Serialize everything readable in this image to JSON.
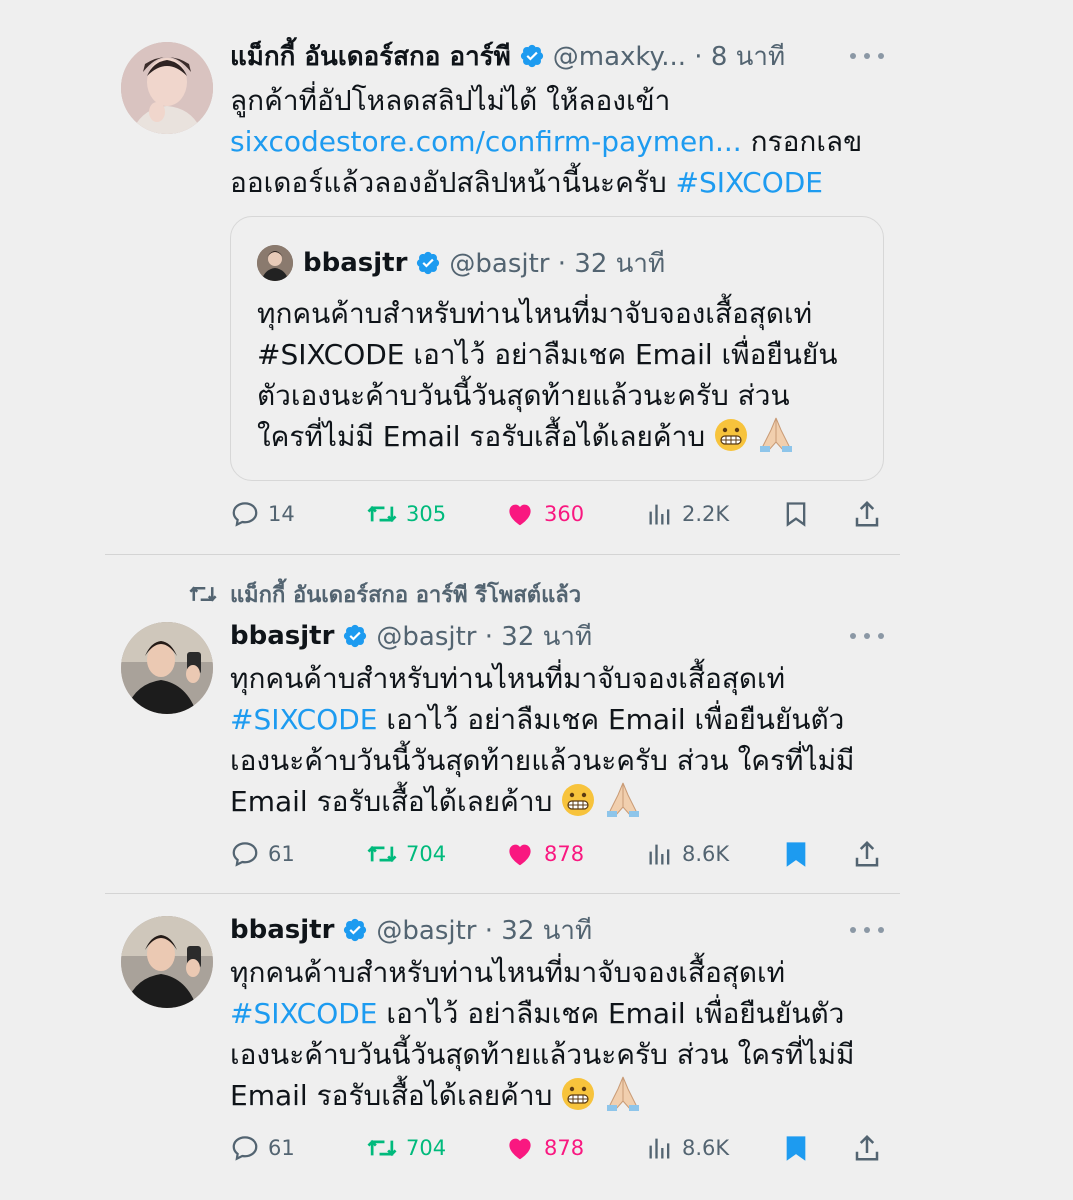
{
  "tweet1": {
    "name": "แม็กกี้ อันเดอร์สกอ อาร์พี",
    "handle_time": "@maxky... · 8 นาที",
    "line1": "ลูกค้าที่อัปโหลดสลิปไม่ได้ ให้ลองเข้า",
    "link": "sixcodestore.com/confirm-paymen...",
    "line2_tail": " กรอกเลข",
    "line3": "ออเดอร์แล้วลองอัปสลิปหน้านี้นะครับ ",
    "hashtag": "#SIXCODE",
    "quote": {
      "name": "bbasjtr",
      "handle_time": "@basjtr · 32 นาที",
      "line1": "ทุกคนค้าบสำหรับท่านไหนที่มาจับจองเสื้อสุดเท่",
      "line2": "#SIXCODE เอาไว้ อย่าลืมเชค Email เพื่อยืนยัน",
      "line3": "ตัวเองนะค้าบวันนี้วันสุดท้ายแล้วนะครับ ส่วน",
      "line4": "ใครที่ไม่มี Email รอรับเสื้อได้เลยค้าบ"
    },
    "replies": "14",
    "reposts": "305",
    "likes": "360",
    "views": "2.2K",
    "bookmarked": false
  },
  "retweet_label": "แม็กกี้ อันเดอร์สกอ อาร์พี รีโพสต์แล้ว",
  "tweet2": {
    "name": "bbasjtr",
    "handle_time": "@basjtr · 32 นาที",
    "line1": "ทุกคนค้าบสำหรับท่านไหนที่มาจับจองเสื้อสุดเท่",
    "hashtag": "#SIXCODE",
    "line2_tail": " เอาไว้ อย่าลืมเชค Email เพื่อยืนยันตัว",
    "line3": "เองนะค้าบวันนี้วันสุดท้ายแล้วนะครับ ส่วน ใครที่ไม่มี",
    "line4": "Email รอรับเสื้อได้เลยค้าบ",
    "replies": "61",
    "reposts": "704",
    "likes": "878",
    "views": "8.6K",
    "bookmarked": true
  },
  "tweet3": {
    "name": "bbasjtr",
    "handle_time": "@basjtr · 32 นาที",
    "line1": "ทุกคนค้าบสำหรับท่านไหนที่มาจับจองเสื้อสุดเท่",
    "hashtag": "#SIXCODE",
    "line2_tail": " เอาไว้ อย่าลืมเชค Email เพื่อยืนยันตัว",
    "line3": "เองนะค้าบวันนี้วันสุดท้ายแล้วนะครับ ส่วน ใครที่ไม่มี",
    "line4": "Email รอรับเสื้อได้เลยค้าบ",
    "replies": "61",
    "reposts": "704",
    "likes": "878",
    "views": "8.6K",
    "bookmarked": true
  },
  "colors": {
    "link": "#1d9bf0",
    "repost": "#00ba7c",
    "like": "#f91880",
    "bookmark": "#1d9bf0",
    "muted": "#536471"
  },
  "icons": [
    "verified-badge-icon",
    "more-icon",
    "reply-icon",
    "repost-icon",
    "like-icon",
    "views-icon",
    "bookmark-icon",
    "share-icon",
    "grimace-emoji",
    "folded-hands-emoji"
  ]
}
